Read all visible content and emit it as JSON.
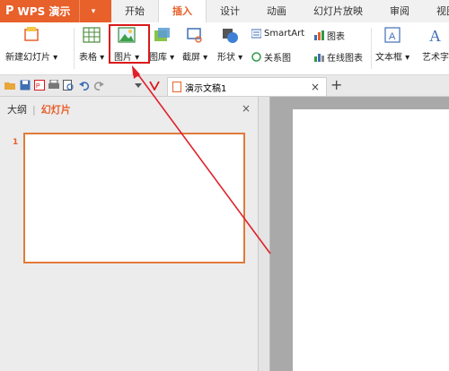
{
  "app": {
    "logo": "P",
    "name": "WPS 演示",
    "menu_arrow": "▾"
  },
  "tabs": [
    {
      "label": "开始",
      "active": false
    },
    {
      "label": "插入",
      "active": true
    },
    {
      "label": "设计",
      "active": false
    },
    {
      "label": "动画",
      "active": false
    },
    {
      "label": "幻灯片放映",
      "active": false
    },
    {
      "label": "审阅",
      "active": false
    },
    {
      "label": "视图",
      "active": false
    }
  ],
  "ribbon": {
    "new_slide": "新建幻灯片 ▾",
    "table": "表格 ▾",
    "picture": "图片 ▾",
    "gallery": "图库 ▾",
    "screenshot": "截屏 ▾",
    "shapes": "形状 ▾",
    "smartart": "SmartArt",
    "relation": "关系图",
    "chart": "图表",
    "online_chart": "在线图表",
    "textbox": "文本框 ▾",
    "wordart": "艺术字"
  },
  "doc_tab": {
    "title": "演示文稿1",
    "close": "×",
    "new": "+"
  },
  "panel": {
    "outline": "大纲",
    "separator": "|",
    "slides": "幻灯片",
    "close": "×",
    "slide_number": "1"
  },
  "colors": {
    "accent": "#e8602a",
    "highlight_box": "#d9181a",
    "arrow": "#e0202a"
  }
}
